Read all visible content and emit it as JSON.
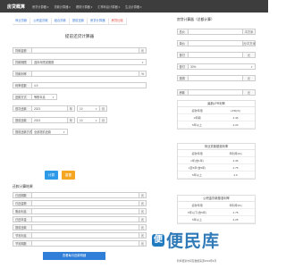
{
  "nav": {
    "brand": "房贷概算",
    "items": [
      "房贷计算器 ▾",
      "贷款计算器 ▾",
      "理财计算器 ▾",
      "汇率利息计算器 ▾",
      "生活计算器 ▾"
    ]
  },
  "tabs": [
    "商业贷款",
    "公积金贷款",
    "组合贷款",
    "提前还款",
    "房贷计算器",
    "房贷比较"
  ],
  "left_title": "提前还贷计算器",
  "form": {
    "amount": {
      "label": "贷款金额",
      "value": "",
      "unit": "元"
    },
    "period": {
      "label": "贷款期限",
      "value": "选择年限或期数"
    },
    "rate_type": {
      "label": "贷款利率",
      "value": "",
      "unit": "%"
    },
    "ratio": {
      "label": "利率倍数",
      "value": "4.9"
    },
    "method": {
      "label": "还款方式",
      "value": "等额本息"
    },
    "first_date": {
      "label": "首次还款",
      "year": "2023",
      "year_unit": "年",
      "month": "10",
      "month_unit": "月"
    },
    "prepay_date": {
      "label": "提前还款",
      "year": "2023",
      "year_unit": "年",
      "month": "10",
      "month_unit": "月"
    },
    "prepay_way": {
      "label": "提前还款方式",
      "value": "全部提前还款"
    }
  },
  "buttons": {
    "calc": "计算",
    "reset": "重置",
    "compute_full": "查看每月还款明细"
  },
  "results": {
    "title": "还款计算结果",
    "rows": [
      {
        "label": "已还期数",
        "unit": "元"
      },
      {
        "label": "已还金额",
        "unit": "元"
      },
      {
        "label": "剩余利息",
        "unit": "元"
      },
      {
        "label": "已还本金",
        "unit": "元"
      },
      {
        "label": "提前还款",
        "unit": "元"
      },
      {
        "label": "节省利息",
        "unit": "元"
      },
      {
        "label": "节省期数",
        "unit": "元"
      }
    ]
  },
  "right": {
    "title": "房贷计算器（总额计算）",
    "rows": [
      {
        "label": "总价",
        "value": "",
        "unit": "平方米"
      },
      {
        "label": "单价",
        "value": "",
        "unit": "元/平方米"
      },
      {
        "label": "首付",
        "value": "",
        "unit": "元"
      },
      {
        "label": "首付",
        "value": "30%",
        "unit": ""
      },
      {
        "label": "按揭",
        "value": "",
        "unit": "元"
      },
      {
        "label": "房款",
        "value": "",
        "unit": "元"
      }
    ]
  },
  "cards": [
    {
      "title": "最新LPR利率",
      "header": [
        "贷款年限",
        "LPR(%)"
      ],
      "rows": [
        [
          "1年期",
          "3.45"
        ],
        [
          "5年以上",
          "4.20"
        ]
      ]
    },
    {
      "title": "商业贷款基准利率",
      "header": [
        "贷款年限",
        "年利率(%)"
      ],
      "rows": [
        [
          "1年(含1年)",
          "4.35"
        ],
        [
          "1至5年(含5年)",
          "4.75"
        ],
        [
          "5年以上",
          "4.9"
        ]
      ]
    },
    {
      "title": "公积金贷款基准利率",
      "header": [
        "贷款年限",
        "年利率(%)"
      ],
      "rows": [
        [
          "5年以下(含5年)",
          "2.75"
        ],
        [
          "5年以上",
          "3.25"
        ]
      ]
    }
  ],
  "footer": "利率更新时间及数据来源2023年6月",
  "watermark": {
    "text": "便民库",
    "icon": "bian-icon"
  }
}
